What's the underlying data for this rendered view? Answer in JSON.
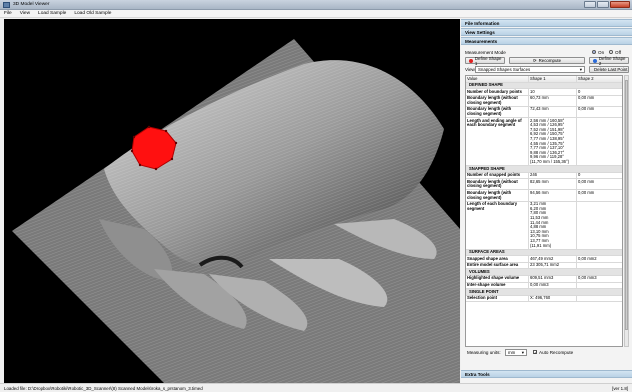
{
  "window": {
    "title": "3D Model Viewer"
  },
  "menu": {
    "items": [
      "File",
      "View",
      "Load Sample",
      "Load Old Sample"
    ]
  },
  "panel": {
    "sections": {
      "file_info": "File Information",
      "view_settings": "View Settings",
      "measurements": "Measurements",
      "extra_tools": "Extra Tools"
    },
    "mode_label": "Measurement Mode",
    "mode_on": "On",
    "mode_off": "Off",
    "define_shape1": "Define Shape 1",
    "recompute": "Recompute",
    "define_shape2": "Define Shape 2",
    "view_label": "View",
    "view_value": "Snapped Shapes Surfaces",
    "delete_last": "Delete Last Point",
    "table": {
      "headers": [
        "Value",
        "Shape 1",
        "Shape 2"
      ],
      "rows": [
        {
          "type": "section",
          "label": "DEFINED SHAPE"
        },
        {
          "type": "data",
          "label": "Number of boundary points",
          "s1": "10",
          "s2": "0"
        },
        {
          "type": "data",
          "label": "Boundary length (without closing segment)",
          "s1": "60,73 mm",
          "s2": "0,00 mm"
        },
        {
          "type": "data",
          "label": "Boundary length (with closing segment)",
          "s1": "72,43 mm",
          "s2": "0,00 mm"
        },
        {
          "type": "data",
          "label": "Length and ending angle of each boundary segment",
          "s1": "2,56 mm / 160,58°\n4,53 mm / 126,95°\n7,52 mm / 151,98°\n6,92 mm / 150,75°\n7,77 mm / 138,95°\n4,55 mm / 135,75°\n7,77 mm / 137,10°\n9,88 mm / 136,27°\n9,96 mm / 119,28°\n(11,70 mm / 155,36°)",
          "s2": ""
        },
        {
          "type": "section",
          "label": "SNAPPED SHAPE"
        },
        {
          "type": "data",
          "label": "Number of snapped points",
          "s1": "246",
          "s2": "0"
        },
        {
          "type": "data",
          "label": "Boundary length (without closing segment)",
          "s1": "82,65 mm",
          "s2": "0,00 mm"
        },
        {
          "type": "data",
          "label": "Boundary length (with closing segment)",
          "s1": "94,56 mm",
          "s2": "0,00 mm"
        },
        {
          "type": "data",
          "label": "Length of each boundary segment",
          "s1": "3,21 mm\n6,20 mm\n7,80 mm\n11,53 mm\n11,44 mm\n4,88 mm\n13,10 mm\n10,75 mm\n13,77 mm\n(11,91 mm)",
          "s2": ""
        },
        {
          "type": "section",
          "label": "SURFACE AREAS"
        },
        {
          "type": "data",
          "label": "Snapped shape area",
          "s1": "467,49 mm2",
          "s2": "0,00 mm2"
        },
        {
          "type": "data",
          "label": "Entire model surface area",
          "s1": "23 305,71 mm2",
          "s2": ""
        },
        {
          "type": "section",
          "label": "VOLUMES"
        },
        {
          "type": "data",
          "label": "Highlighted shape volume",
          "s1": "609,51 mm3",
          "s2": "0,00 mm3"
        },
        {
          "type": "data",
          "label": "Inter-shape volume",
          "s1": "0,00 mm3",
          "s2": ""
        },
        {
          "type": "section",
          "label": "SINGLE POINT"
        },
        {
          "type": "data",
          "label": "Selection point",
          "s1": "X: 496,760",
          "s2": ""
        }
      ]
    },
    "units_label": "Measuring units:",
    "units_value": "mm",
    "auto_recompute": "Auto Recompute"
  },
  "status": {
    "loaded": "Loaded file: D:\\Dropbox\\Robotiki\\Robotic_3D_Scanner\\(8) Scanned Models\\roka_s_prstanom_3.timed",
    "version": "[ver 1.8]"
  },
  "colors": {
    "accent": "#1b4fd8",
    "shape1": "#e02020",
    "shape2": "#2a6ad8",
    "selection": "#ff1010"
  }
}
